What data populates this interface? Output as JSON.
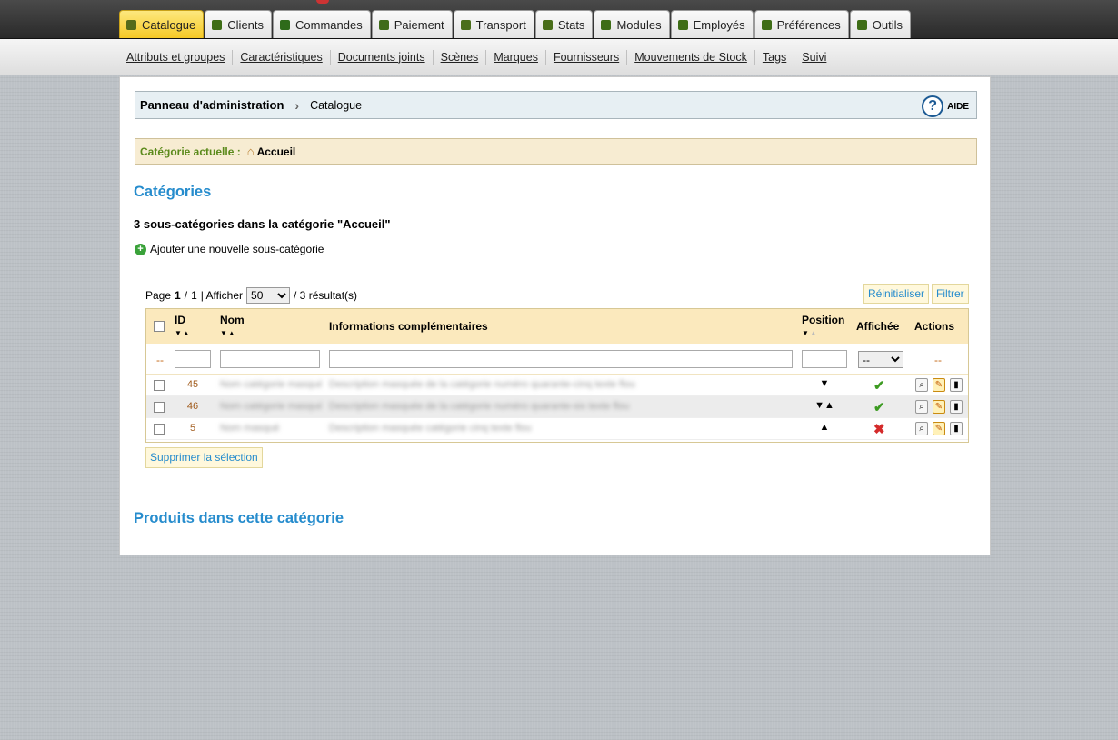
{
  "tabs": [
    {
      "label": "Catalogue",
      "icon": "book-icon",
      "active": true
    },
    {
      "label": "Clients",
      "icon": "person-icon"
    },
    {
      "label": "Commandes",
      "icon": "cart-icon"
    },
    {
      "label": "Paiement",
      "icon": "card-icon"
    },
    {
      "label": "Transport",
      "icon": "truck-icon"
    },
    {
      "label": "Stats",
      "icon": "chart-icon"
    },
    {
      "label": "Modules",
      "icon": "puzzle-icon"
    },
    {
      "label": "Employés",
      "icon": "building-icon"
    },
    {
      "label": "Préférences",
      "icon": "sliders-icon"
    },
    {
      "label": "Outils",
      "icon": "tools-icon"
    }
  ],
  "subnav": [
    "Attributs et groupes",
    "Caractéristiques",
    "Documents joints",
    "Scènes",
    "Marques",
    "Fournisseurs",
    "Mouvements de Stock",
    "Tags",
    "Suivi"
  ],
  "breadcrumb": {
    "root": "Panneau d'administration",
    "current": "Catalogue",
    "help": "AIDE"
  },
  "current_category": {
    "label": "Catégorie actuelle :",
    "value": "Accueil"
  },
  "categories_title": "Catégories",
  "subcategory_count": "3 sous-catégories dans la catégorie \"Accueil\"",
  "add_subcategory": "Ajouter une nouvelle sous-catégorie",
  "pager": {
    "page_label": "Page",
    "page": "1",
    "sep": "/",
    "total_pages": "1",
    "show_label": "| Afficher",
    "per_page": "50",
    "results": "/ 3 résultat(s)"
  },
  "buttons": {
    "reset": "Réinitialiser",
    "filter": "Filtrer",
    "delete_selection": "Supprimer la sélection"
  },
  "columns": {
    "id": "ID",
    "name": "Nom",
    "info": "Informations complémentaires",
    "position": "Position",
    "shown": "Affichée",
    "actions": "Actions"
  },
  "filter_row": {
    "dash": "--",
    "shown_select": "--"
  },
  "rows": [
    {
      "id": "45",
      "name": "Nom catégorie masqué",
      "info": "Description masquée de la catégorie numéro quarante-cinq texte flou",
      "position": "▼",
      "shown": true
    },
    {
      "id": "46",
      "name": "Nom catégorie masqué",
      "info": "Description masquée de la catégorie numéro quarante-six texte flou",
      "position": "▼▲",
      "shown": true
    },
    {
      "id": "5",
      "name": "Nom masqué",
      "info": "Description masquée catégorie cinq texte flou",
      "position": "▲",
      "shown": false
    }
  ],
  "products_title": "Produits dans cette catégorie"
}
